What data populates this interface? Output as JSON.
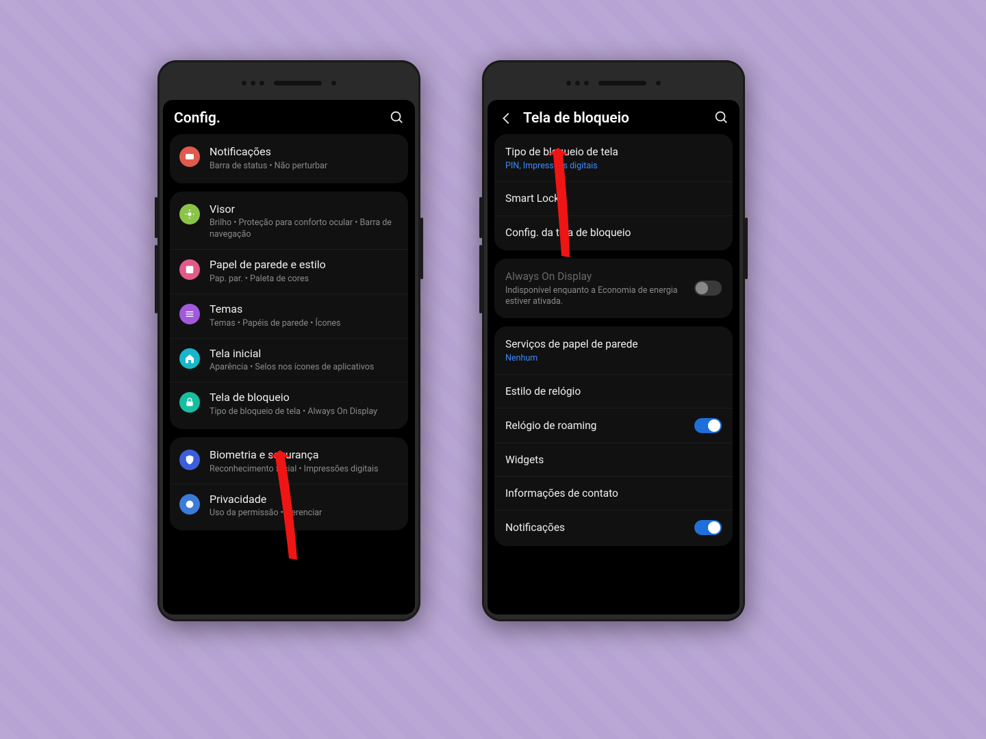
{
  "left": {
    "title": "Config.",
    "groups": [
      {
        "items": [
          {
            "icon_name": "notifications-icon",
            "icon_color": "#e05a4e",
            "title": "Notificações",
            "sub": "Barra de status  •  Não perturbar"
          }
        ]
      },
      {
        "items": [
          {
            "icon_name": "display-icon",
            "icon_color": "#8bc34a",
            "title": "Visor",
            "sub": "Brilho  •  Proteção para conforto ocular  •  Barra de navegação"
          },
          {
            "icon_name": "wallpaper-icon",
            "icon_color": "#e05a8a",
            "title": "Papel de parede e estilo",
            "sub": "Pap. par.  •  Paleta de cores"
          },
          {
            "icon_name": "themes-icon",
            "icon_color": "#a05adb",
            "title": "Temas",
            "sub": "Temas  •  Papéis de parede  •  Ícones"
          },
          {
            "icon_name": "home-icon",
            "icon_color": "#17b6c9",
            "title": "Tela inicial",
            "sub": "Aparência  •  Selos nos ícones de aplicativos"
          },
          {
            "icon_name": "lock-icon",
            "icon_color": "#15bfa0",
            "title": "Tela de bloqueio",
            "sub": "Tipo de bloqueio de tela  •  Always On Display"
          }
        ]
      },
      {
        "items": [
          {
            "icon_name": "shield-icon",
            "icon_color": "#3b5fd9",
            "title": "Biometria e segurança",
            "sub": "Reconhecimento facial  •  Impressões digitais"
          },
          {
            "icon_name": "privacy-icon",
            "icon_color": "#3b7bd9",
            "title": "Privacidade",
            "sub": "Uso da permissão  •  Gerenciar"
          }
        ]
      }
    ]
  },
  "right": {
    "title": "Tela de bloqueio",
    "groups": [
      {
        "items": [
          {
            "title": "Tipo de bloqueio de tela",
            "sub": "PIN, Impressões digitais",
            "sub_style": "blue"
          },
          {
            "title": "Smart Lock"
          },
          {
            "title": "Config. da tela de bloqueio"
          }
        ]
      },
      {
        "items": [
          {
            "title": "Always On Display",
            "sub": "Indisponível enquanto a Economia de energia estiver ativada.",
            "sub_style": "gray",
            "disabled": true,
            "toggle": false
          }
        ]
      },
      {
        "items": [
          {
            "title": "Serviços de papel de parede",
            "sub": "Nenhum",
            "sub_style": "blue"
          },
          {
            "title": "Estilo de relógio"
          },
          {
            "title": "Relógio de roaming",
            "toggle": true
          },
          {
            "title": "Widgets"
          },
          {
            "title": "Informações de contato"
          },
          {
            "title": "Notificações",
            "toggle": true
          }
        ]
      }
    ]
  }
}
